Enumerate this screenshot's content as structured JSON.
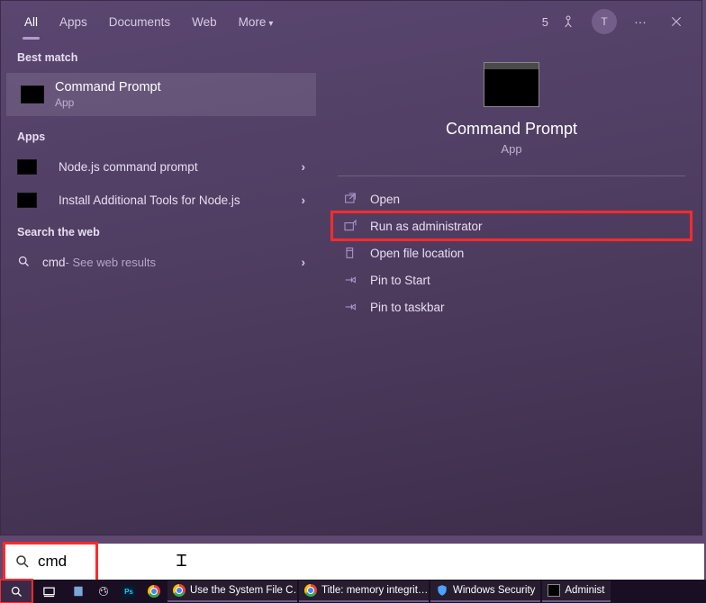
{
  "tabs": [
    "All",
    "Apps",
    "Documents",
    "Web",
    "More"
  ],
  "active_tab": 0,
  "header": {
    "reward_count": "5",
    "user_initial": "T"
  },
  "sections": {
    "best_match_h": "Best match",
    "apps_h": "Apps",
    "web_h": "Search the web"
  },
  "best_match": {
    "title": "Command Prompt",
    "sub": "App"
  },
  "apps": [
    "Node.js command prompt",
    "Install Additional Tools for Node.js"
  ],
  "web": {
    "term": "cmd",
    "suffix": " - See web results"
  },
  "detail": {
    "title": "Command Prompt",
    "sub": "App"
  },
  "actions": [
    "Open",
    "Run as administrator",
    "Open file location",
    "Pin to Start",
    "Pin to taskbar"
  ],
  "search": {
    "value": "cmd"
  },
  "taskbar": [
    {
      "label": "Use the System File C…"
    },
    {
      "label": "Title: memory integrit…"
    },
    {
      "label": "Windows Security"
    },
    {
      "label": "Administ"
    }
  ]
}
